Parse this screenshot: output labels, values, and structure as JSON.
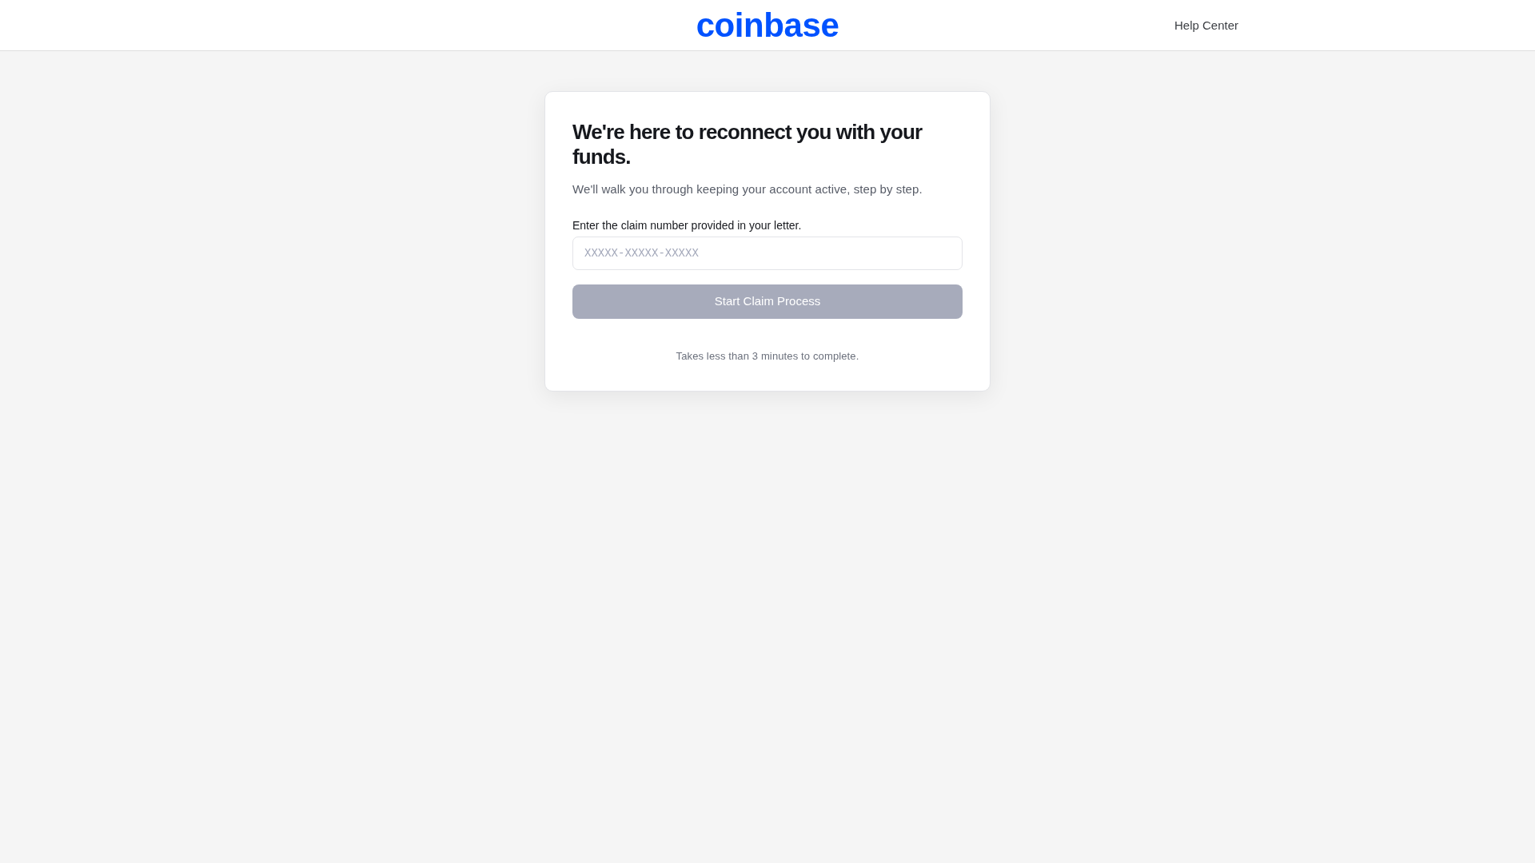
{
  "header": {
    "logo": "coinbase",
    "help_link": "Help Center"
  },
  "card": {
    "title": "We're here to reconnect you with your funds.",
    "subtitle": "We'll walk you through keeping your account active, step by step.",
    "field": {
      "label": "Enter the claim number provided in your letter.",
      "placeholder": "XXXXX-XXXXX-XXXXX"
    },
    "button": {
      "label": "Start Claim Process",
      "disabled": true
    },
    "note": "Takes less than 3 minutes to complete."
  }
}
